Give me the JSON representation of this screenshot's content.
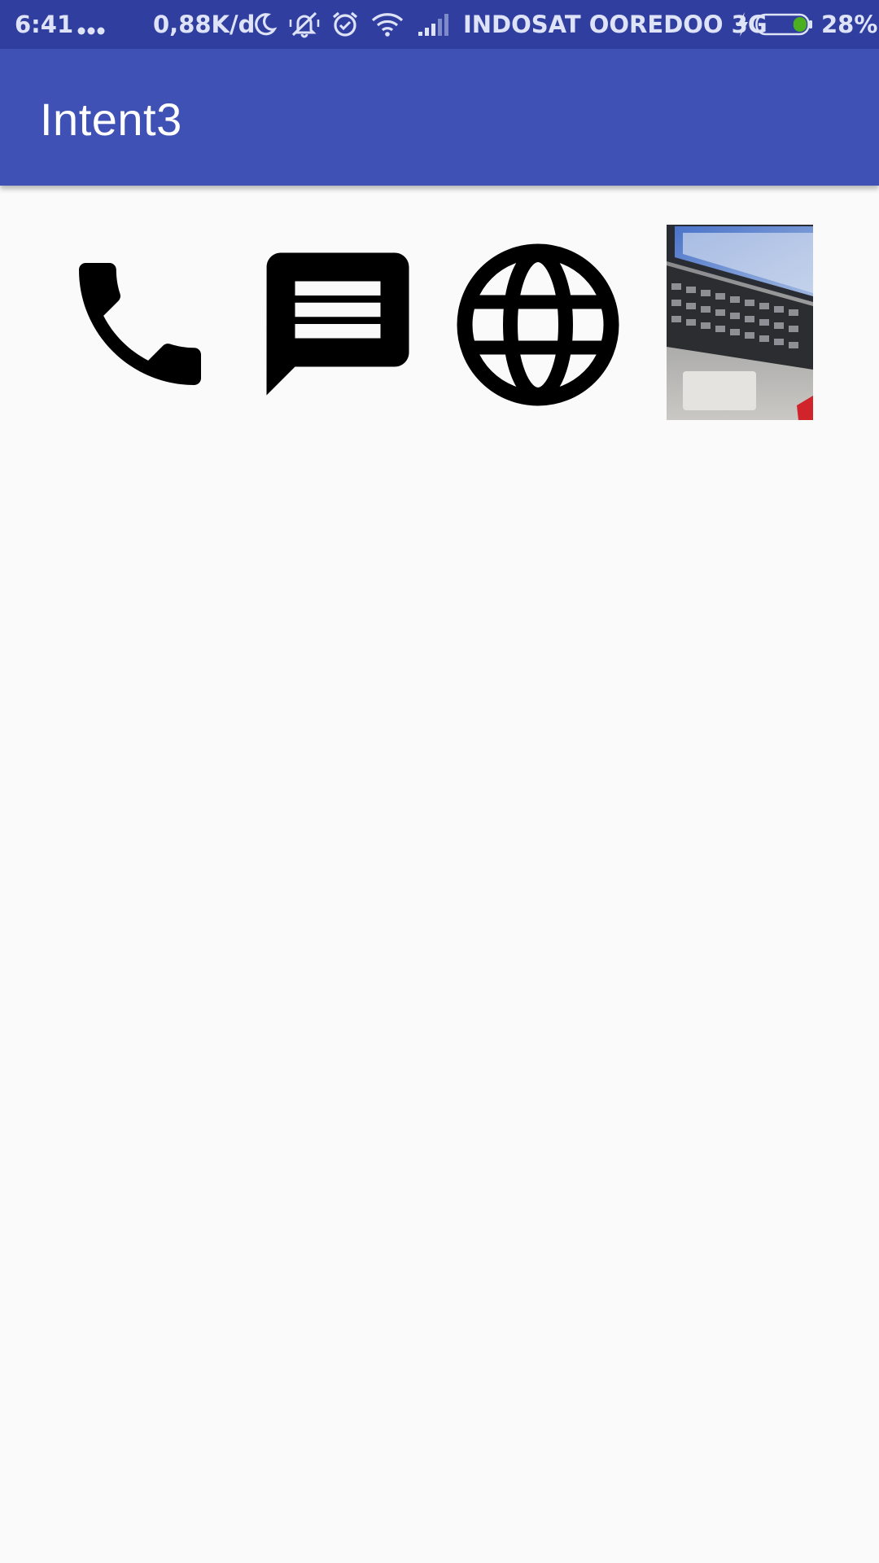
{
  "status_bar": {
    "time": "6:41",
    "dots": "...",
    "data_speed": "0,88K/d",
    "carrier": "INDOSAT OOREDOO 3G",
    "battery_percent": "28%",
    "battery_level": 0.28,
    "icons": [
      "moon-icon",
      "silent-bell-icon",
      "alarm-icon",
      "wifi-icon",
      "signal-icon",
      "charging-icon",
      "battery-icon"
    ],
    "colors": {
      "background": "#303f9f",
      "text": "#dfe3f7",
      "battery_fill": "#4caf1f"
    }
  },
  "app_bar": {
    "title": "Intent3",
    "colors": {
      "background": "#3f51b5",
      "title": "#ffffff"
    }
  },
  "content": {
    "buttons": [
      {
        "name": "phone-button",
        "icon": "phone-icon"
      },
      {
        "name": "message-button",
        "icon": "message-icon"
      },
      {
        "name": "web-button",
        "icon": "globe-icon"
      },
      {
        "name": "camera-photo-button",
        "icon": "photo-thumbnail"
      }
    ],
    "colors": {
      "background": "#fafafa",
      "icon": "#000000"
    }
  }
}
